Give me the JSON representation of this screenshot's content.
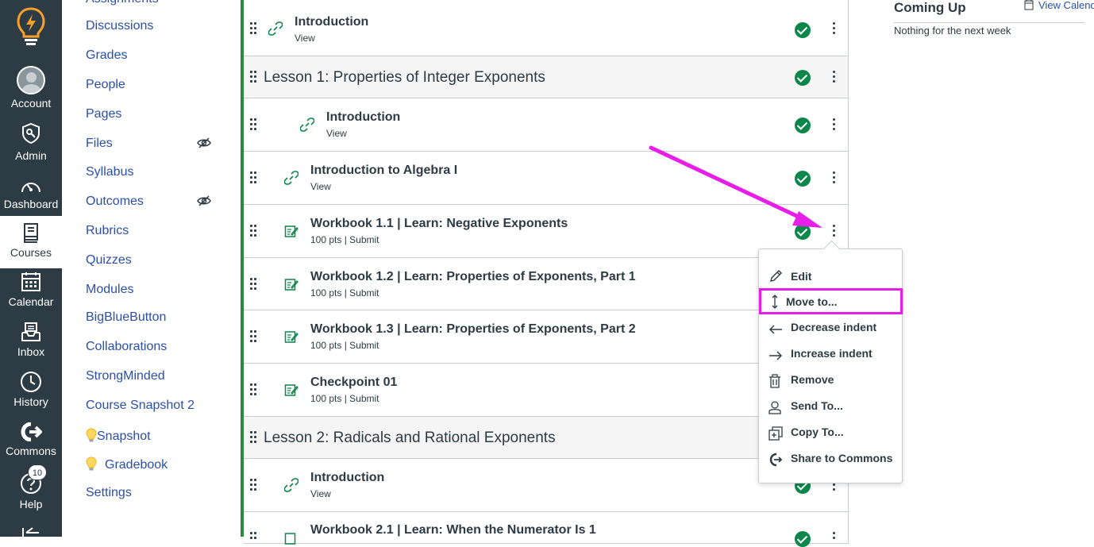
{
  "global_nav": {
    "account": "Account",
    "admin": "Admin",
    "dashboard": "Dashboard",
    "courses": "Courses",
    "calendar": "Calendar",
    "inbox": "Inbox",
    "history": "History",
    "commons": "Commons",
    "help": "Help",
    "help_badge": "10"
  },
  "course_nav": {
    "items": [
      "Assignments",
      "Discussions",
      "Grades",
      "People",
      "Pages",
      "Files",
      "Syllabus",
      "Outcomes",
      "Rubrics",
      "Quizzes",
      "Modules",
      "BigBlueButton",
      "Collaborations",
      "StrongMinded",
      "Course Snapshot 2",
      "Snapshot",
      "Gradebook",
      "Settings"
    ]
  },
  "modules": {
    "rows": [
      {
        "title": "Introduction",
        "sub": "View"
      },
      {
        "title": "Lesson 1: Properties of Integer Exponents"
      },
      {
        "title": "Introduction",
        "sub": "View"
      },
      {
        "title": "Introduction to Algebra I",
        "sub": "View"
      },
      {
        "title": "Workbook 1.1 | Learn: Negative Exponents",
        "sub": "100 pts  |  Submit"
      },
      {
        "title": "Workbook 1.2 | Learn: Properties of Exponents, Part 1",
        "sub": "100 pts  |  Submit"
      },
      {
        "title": "Workbook 1.3 | Learn: Properties of Exponents, Part 2",
        "sub": "100 pts  |  Submit"
      },
      {
        "title": "Checkpoint 01",
        "sub": "100 pts  |  Submit"
      },
      {
        "title": "Lesson 2: Radicals and Rational Exponents"
      },
      {
        "title": "Introduction",
        "sub": "View"
      },
      {
        "title": "Workbook 2.1 | Learn: When the Numerator Is 1"
      }
    ]
  },
  "menu": {
    "items": [
      "Edit",
      "Move to...",
      "Decrease indent",
      "Increase indent",
      "Remove",
      "Send To...",
      "Copy To...",
      "Share to Commons"
    ]
  },
  "sidebar": {
    "coming_up": "Coming Up",
    "view_calendar": "View Calendar",
    "empty": "Nothing for the next week"
  },
  "colors": {
    "nav_bg": "#2d3b45",
    "link": "#2b4fa7",
    "complete": "#0b874b",
    "module_border": "#2b8a3e",
    "highlight": "#e61ee8"
  }
}
